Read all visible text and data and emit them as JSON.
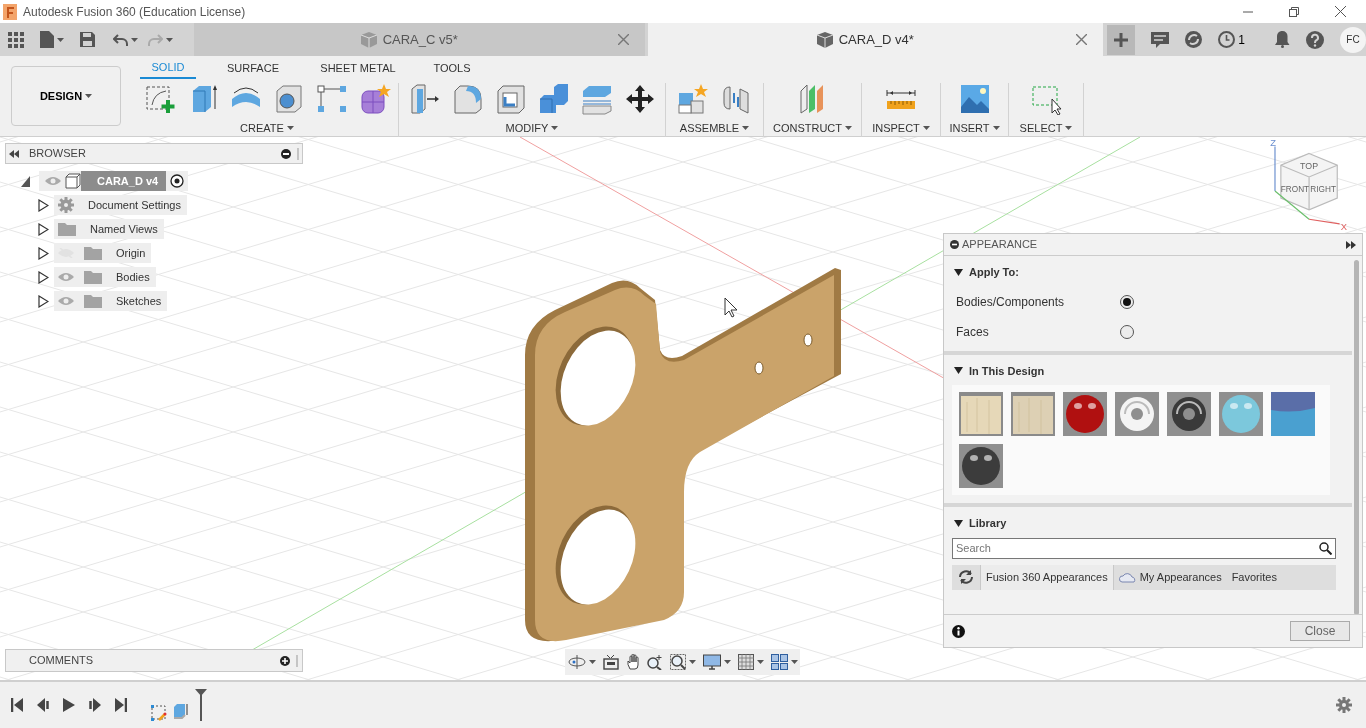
{
  "window": {
    "title": "Autodesk Fusion 360 (Education License)"
  },
  "doc_tabs": [
    {
      "label": "CARA_C v5*",
      "selected": false
    },
    {
      "label": "CARA_D v4*",
      "selected": true
    }
  ],
  "header": {
    "jobs_count": "1",
    "user_initials": "FC"
  },
  "workspace": {
    "label": "DESIGN"
  },
  "ribbon_tabs": [
    {
      "label": "SOLID",
      "selected": true
    },
    {
      "label": "SURFACE",
      "selected": false
    },
    {
      "label": "SHEET METAL",
      "selected": false
    },
    {
      "label": "TOOLS",
      "selected": false
    }
  ],
  "ribbon_groups": [
    {
      "label": "CREATE"
    },
    {
      "label": "MODIFY"
    },
    {
      "label": "ASSEMBLE"
    },
    {
      "label": "CONSTRUCT"
    },
    {
      "label": "INSPECT"
    },
    {
      "label": "INSERT"
    },
    {
      "label": "SELECT"
    }
  ],
  "browser": {
    "title": "BROWSER",
    "root": {
      "label": "CARA_D v4",
      "expanded": true,
      "children": [
        {
          "label": "Document Settings",
          "kind": "settings",
          "expanded": false
        },
        {
          "label": "Named Views",
          "kind": "folder",
          "expanded": false
        },
        {
          "label": "Origin",
          "kind": "toggle",
          "visible": false,
          "expanded": false
        },
        {
          "label": "Bodies",
          "kind": "toggle",
          "visible": true,
          "expanded": false
        },
        {
          "label": "Sketches",
          "kind": "toggle",
          "visible": true,
          "expanded": false
        }
      ]
    }
  },
  "viewcube": {
    "faces": [
      "TOP",
      "FRONT",
      "RIGHT"
    ],
    "axes": [
      "Z",
      "X"
    ]
  },
  "appearance": {
    "title": "APPEARANCE",
    "apply_to": {
      "title": "Apply To:",
      "expanded": true,
      "options": [
        {
          "label": "Bodies/Components",
          "selected": true
        },
        {
          "label": "Faces",
          "selected": false
        }
      ]
    },
    "in_design": {
      "title": "In This Design",
      "expanded": true,
      "swatches": [
        {
          "kind": "wood",
          "color": "#e6d8b8"
        },
        {
          "kind": "wood",
          "color": "#ddd0b4"
        },
        {
          "kind": "sphere",
          "color": "#b01010"
        },
        {
          "kind": "torus",
          "color": "#f4f4f4"
        },
        {
          "kind": "torus",
          "color": "#3a3a3a"
        },
        {
          "kind": "sphere",
          "color": "#7cc8dc"
        },
        {
          "kind": "paint",
          "color": "#4aa0d0"
        },
        {
          "kind": "sphere",
          "color": "#3c3c3c"
        }
      ]
    },
    "library": {
      "title": "Library",
      "expanded": true,
      "search": {
        "placeholder": "Search"
      },
      "tabs": [
        {
          "label": "Fusion 360 Appearances",
          "kind": "local",
          "selected": true
        },
        {
          "label": "My Appearances",
          "kind": "cloud",
          "selected": false
        },
        {
          "label": "Favorites",
          "kind": "plain",
          "selected": false
        }
      ]
    },
    "close_label": "Close"
  },
  "comments": {
    "title": "COMMENTS"
  }
}
